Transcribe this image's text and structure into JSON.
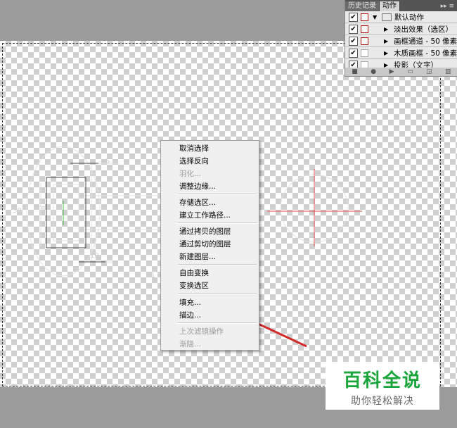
{
  "panel": {
    "tabs": [
      "历史记录",
      "动作"
    ],
    "menu_icon": "▸▸ ≡",
    "check": "✔",
    "actions": [
      {
        "label": "默认动作",
        "type": "folder"
      },
      {
        "label": "淡出效果（选区）",
        "type": "action"
      },
      {
        "label": "画框通道 - 50 像素",
        "type": "action"
      },
      {
        "label": "木质画框 - 50 像素",
        "type": "action"
      },
      {
        "label": "投影（文字）",
        "type": "action"
      }
    ],
    "bottom_icons": [
      "stop-icon",
      "record-icon",
      "play-icon",
      "new-set-icon",
      "new-action-icon",
      "trash-icon"
    ]
  },
  "context_menu": {
    "items": [
      {
        "label": "取消选择",
        "enabled": true
      },
      {
        "label": "选择反向",
        "enabled": true
      },
      {
        "label": "羽化...",
        "enabled": false
      },
      {
        "label": "调整边缘...",
        "enabled": true
      },
      {
        "label": "存储选区...",
        "enabled": true
      },
      {
        "label": "建立工作路径...",
        "enabled": true
      },
      {
        "label": "通过拷贝的图层",
        "enabled": true
      },
      {
        "label": "通过剪切的图层",
        "enabled": true
      },
      {
        "label": "新建图层...",
        "enabled": true
      },
      {
        "label": "自由变换",
        "enabled": true
      },
      {
        "label": "变换选区",
        "enabled": true
      },
      {
        "label": "填充...",
        "enabled": true
      },
      {
        "label": "描边...",
        "enabled": true
      },
      {
        "label": "上次滤镜操作",
        "enabled": false
      },
      {
        "label": "渐隐...",
        "enabled": false
      }
    ]
  },
  "drawing": {
    "dims": [
      "5",
      "30",
      "8",
      "10",
      "41"
    ],
    "arrow_color": "#d42a2a",
    "center_line_color": "#e05050"
  },
  "watermark": {
    "title": "百科全说",
    "subtitle": "助你轻松解决",
    "color": "#1aa53a"
  }
}
